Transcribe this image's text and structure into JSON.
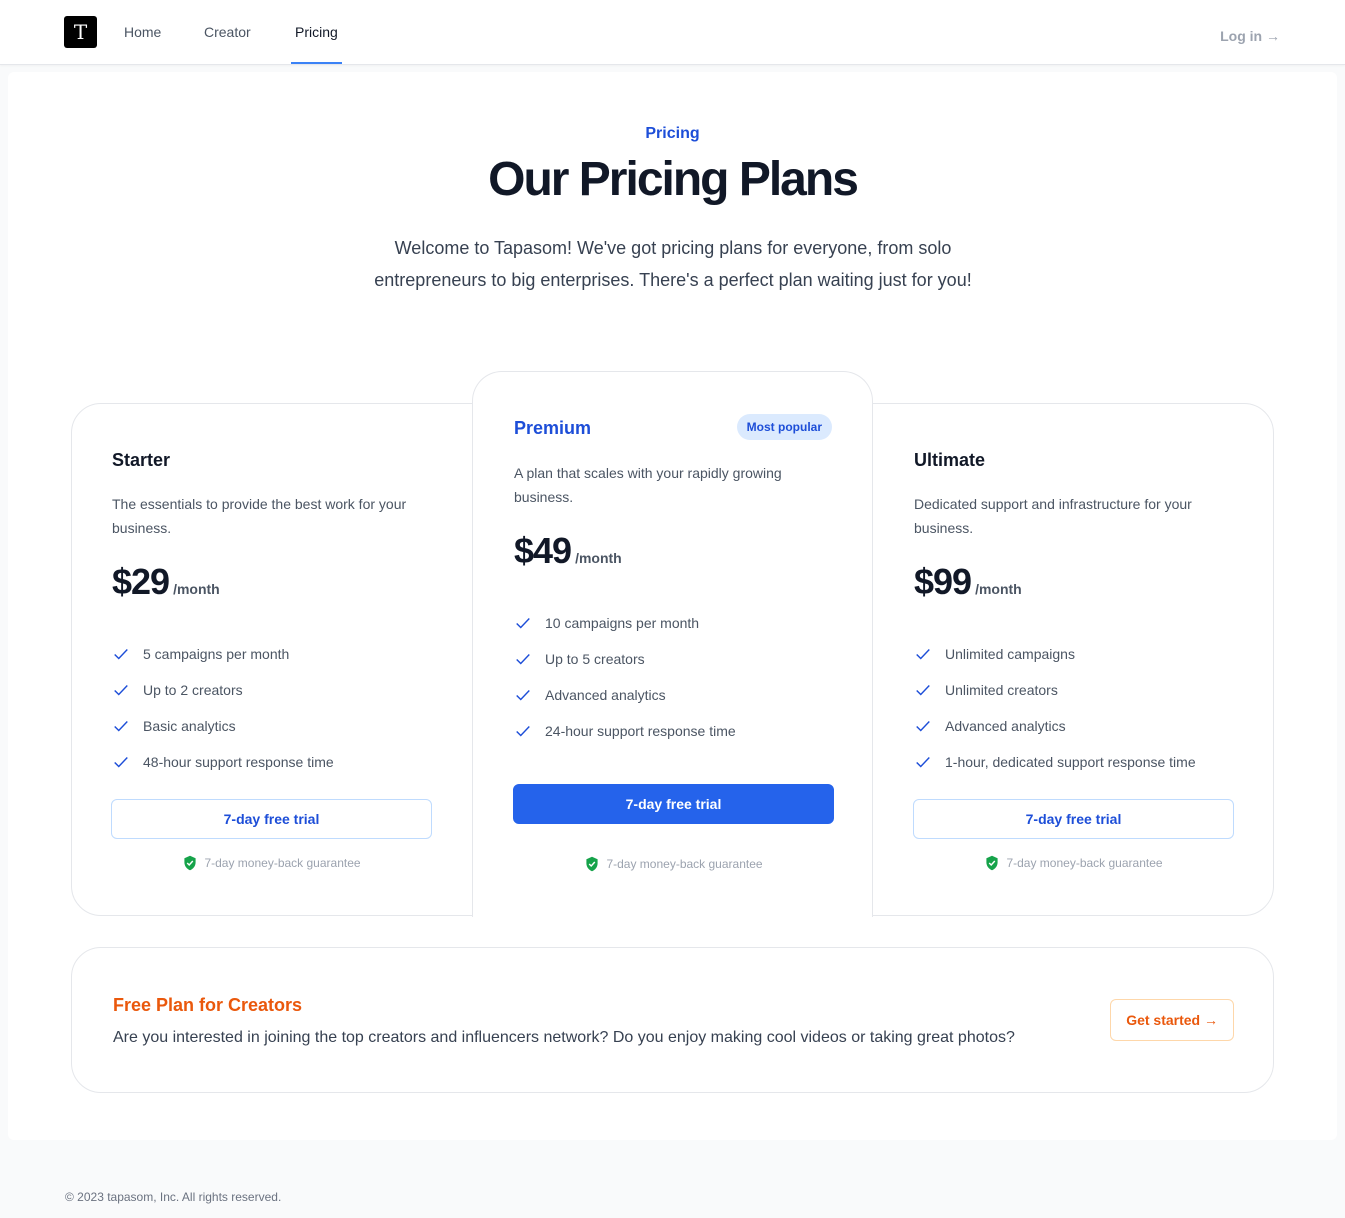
{
  "header": {
    "logo_letter": "T",
    "nav": [
      {
        "label": "Home"
      },
      {
        "label": "Creator"
      },
      {
        "label": "Pricing"
      }
    ],
    "login_label": "Log in →"
  },
  "hero": {
    "eyebrow": "Pricing",
    "title": "Our Pricing Plans",
    "subtitle": "Welcome to Tapasom! We've got pricing plans for everyone, from solo entrepreneurs to big enterprises. There's a perfect plan waiting just for you!"
  },
  "plans": [
    {
      "name": "Starter",
      "description": "The essentials to provide the best work for your business.",
      "price": "$29",
      "period": "/month",
      "features": [
        "5 campaigns per month",
        "Up to 2 creators",
        "Basic analytics",
        "48-hour support response time"
      ],
      "cta": "7-day free trial",
      "guarantee": "7-day money-back guarantee"
    },
    {
      "name": "Premium",
      "badge": "Most popular",
      "description": "A plan that scales with your rapidly growing business.",
      "price": "$49",
      "period": "/month",
      "features": [
        "10 campaigns per month",
        "Up to 5 creators",
        "Advanced analytics",
        "24-hour support response time"
      ],
      "cta": "7-day free trial",
      "guarantee": "7-day money-back guarantee"
    },
    {
      "name": "Ultimate",
      "description": "Dedicated support and infrastructure for your business.",
      "price": "$99",
      "period": "/month",
      "features": [
        "Unlimited campaigns",
        "Unlimited creators",
        "Advanced analytics",
        "1-hour, dedicated support response time"
      ],
      "cta": "7-day free trial",
      "guarantee": "7-day money-back guarantee"
    }
  ],
  "free_plan": {
    "title": "Free Plan for Creators",
    "description": "Are you interested in joining the top creators and influencers network? Do you enjoy making cool videos or taking great photos?",
    "cta": "Get started →"
  },
  "footer": {
    "copyright": "© 2023 tapasom, Inc. All rights reserved."
  },
  "colors": {
    "accent": "#2563eb",
    "accent_text": "#1d4ed8",
    "free_plan_accent": "#ea580c",
    "guarantee_icon": "#16a34a"
  },
  "icons": {
    "feature": "check-icon",
    "guarantee": "shield-check-icon"
  }
}
